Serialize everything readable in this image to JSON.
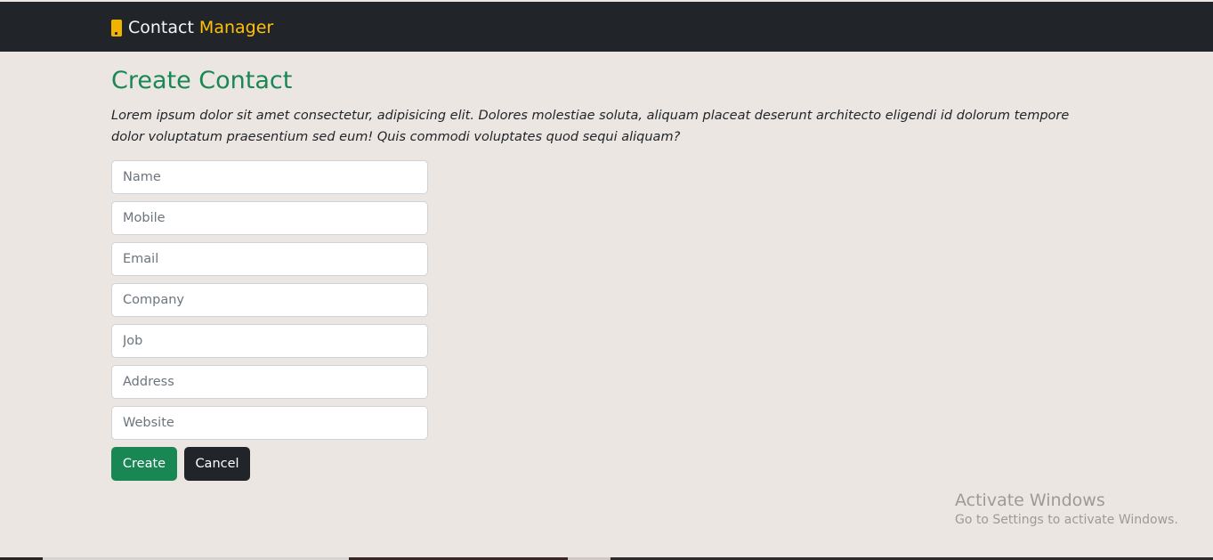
{
  "navbar": {
    "brand_part1": "Contact",
    "brand_part2": "Manager",
    "icon": "mobile-phone-icon",
    "background_color": "#212529",
    "accent_color": "#ffc107"
  },
  "main": {
    "title": "Create Contact",
    "title_color": "#198754",
    "intro": "Lorem ipsum dolor sit amet consectetur, adipisicing elit. Dolores molestiae soluta, aliquam placeat deserunt architecto eligendi id dolorum tempore dolor voluptatum praesentium sed eum! Quis commodi voluptates quod sequi aliquam?"
  },
  "form": {
    "fields": [
      {
        "placeholder": "Name",
        "value": ""
      },
      {
        "placeholder": "Mobile",
        "value": ""
      },
      {
        "placeholder": "Email",
        "value": ""
      },
      {
        "placeholder": "Company",
        "value": ""
      },
      {
        "placeholder": "Job",
        "value": ""
      },
      {
        "placeholder": "Address",
        "value": ""
      },
      {
        "placeholder": "Website",
        "value": ""
      }
    ],
    "create_label": "Create",
    "cancel_label": "Cancel"
  },
  "watermark": {
    "title": "Activate Windows",
    "subtitle": "Go to Settings to activate Windows."
  }
}
